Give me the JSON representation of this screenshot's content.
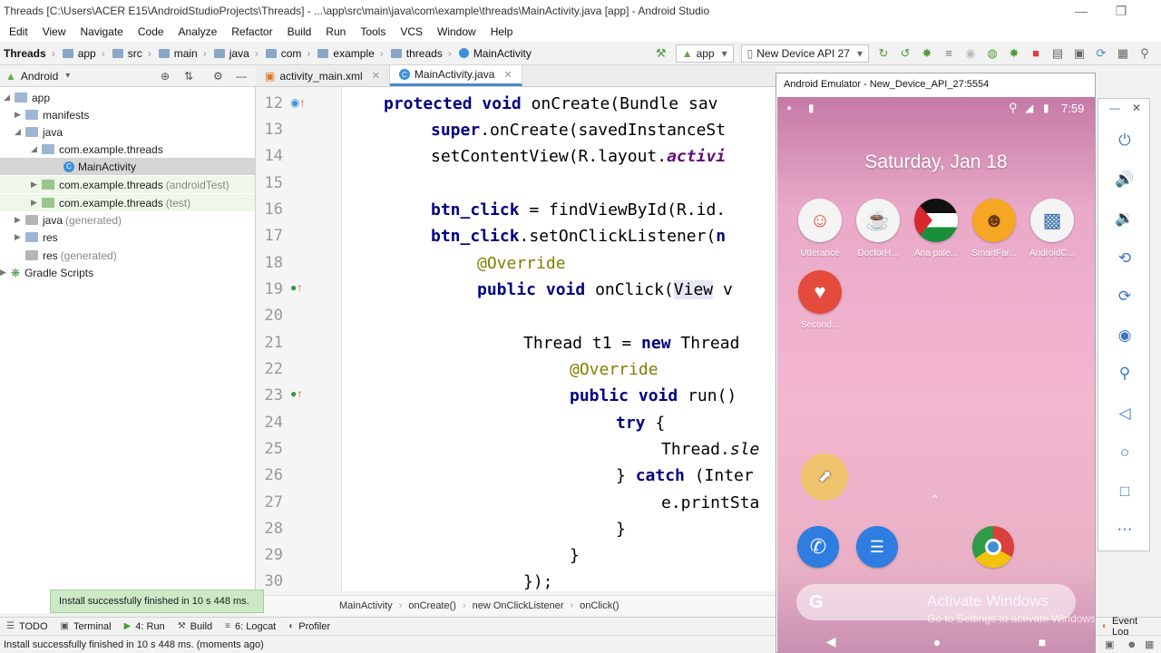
{
  "window": {
    "title": "Threads [C:\\Users\\ACER E15\\AndroidStudioProjects\\Threads] - ...\\app\\src\\main\\java\\com\\example\\threads\\MainActivity.java [app] - Android Studio"
  },
  "menu": [
    "Edit",
    "View",
    "Navigate",
    "Code",
    "Analyze",
    "Refactor",
    "Build",
    "Run",
    "Tools",
    "VCS",
    "Window",
    "Help"
  ],
  "breadcrumbs": [
    "Threads",
    "app",
    "src",
    "main",
    "java",
    "com",
    "example",
    "threads",
    "MainActivity"
  ],
  "toolbar": {
    "run_config": "app",
    "device": "New Device API 27"
  },
  "project_panel": {
    "view_label": "Android",
    "tree": [
      {
        "label": "app",
        "extra": ""
      },
      {
        "label": "manifests",
        "extra": ""
      },
      {
        "label": "java",
        "extra": ""
      },
      {
        "label": "com.example.threads",
        "extra": ""
      },
      {
        "label": "MainActivity",
        "extra": ""
      },
      {
        "label": "com.example.threads",
        "extra": "(androidTest)"
      },
      {
        "label": "com.example.threads",
        "extra": "(test)"
      },
      {
        "label": "java",
        "extra": "(generated)"
      },
      {
        "label": "res",
        "extra": ""
      },
      {
        "label": "res",
        "extra": "(generated)"
      },
      {
        "label": "Gradle Scripts",
        "extra": ""
      }
    ]
  },
  "editor": {
    "tabs": [
      {
        "label": "activity_main.xml",
        "active": false
      },
      {
        "label": "MainActivity.java",
        "active": true
      }
    ],
    "line_numbers": [
      "12",
      "13",
      "14",
      "15",
      "16",
      "17",
      "18",
      "19",
      "20",
      "21",
      "22",
      "23",
      "24",
      "25",
      "26",
      "27",
      "28",
      "29",
      "30"
    ],
    "lines": {
      "l12a": "protected",
      "l12b": "void",
      "l12c": " onCreate(Bundle sav",
      "l13a": "super",
      "l13b": ".onCreate(savedInstanceSt",
      "l14a": "setContentView(R.layout.",
      "l14b": "activi",
      "l16a": "btn_click",
      "l16b": " = findViewById(R.id.",
      "l17a": "btn_click",
      "l17b": ".setOnClickListener(",
      "l17c": "n",
      "l18": "@Override",
      "l19a": "public",
      "l19b": "void",
      "l19c": " onClick(",
      "l19d": "View",
      "l19e": " v",
      "l21a": "Thread t1 = ",
      "l21b": "new",
      "l21c": " Thread",
      "l22": "@Override",
      "l23a": "public",
      "l23b": "void",
      "l23c": " run()",
      "l24a": "try",
      "l24b": " {",
      "l25a": "Thread.",
      "l25b": "sle",
      "l26a": "} ",
      "l26b": "catch",
      "l26c": " (Inter",
      "l27": "e.printSta",
      "l28": "}",
      "l29": "}",
      "l30": "});"
    },
    "bottom_breadcrumb": [
      "MainActivity",
      "onCreate()",
      "new OnClickListener",
      "onClick()"
    ]
  },
  "notification": "Install successfully finished in 10 s 448 ms.",
  "tool_windows": [
    {
      "label": "TODO",
      "icon": "list-icon"
    },
    {
      "label": "Terminal",
      "icon": "terminal-icon"
    },
    {
      "label": "4: Run",
      "icon": "play-icon"
    },
    {
      "label": "Build",
      "icon": "hammer-icon"
    },
    {
      "label": "6: Logcat",
      "icon": "logcat-icon"
    },
    {
      "label": "Profiler",
      "icon": "gauge-icon"
    }
  ],
  "event_log": "Event Log",
  "status": "Install successfully finished in 10 s 448 ms. (moments ago)",
  "emulator": {
    "title": "Android Emulator - New_Device_API_27:5554",
    "time": "7:59",
    "date": "Saturday, Jan 18",
    "apps": [
      {
        "label": "Utterance",
        "color": "#f4f4f4"
      },
      {
        "label": "DoctorH...",
        "color": "#f4f4f4"
      },
      {
        "label": "Ana pale...",
        "color": "#e8e8e8"
      },
      {
        "label": "SmartFar...",
        "color": "#f5a623"
      },
      {
        "label": "AndroidC...",
        "color": "#f4f4f4"
      },
      {
        "label": "Second...",
        "color": "#e54b3c"
      }
    ],
    "watermark_title": "Activate Windows",
    "watermark_sub": "Go to Settings to activate Windows."
  },
  "colors": {
    "accent": "#4a88c7",
    "keyword": "#000080",
    "annotation": "#808000",
    "toast_bg": "#cce8c4"
  }
}
